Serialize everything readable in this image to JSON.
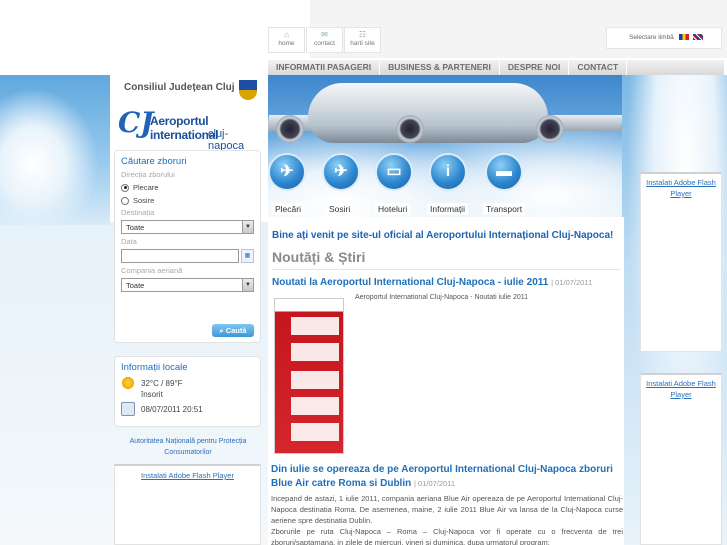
{
  "top_nav": [
    {
      "label": "home",
      "icon": "home-icon"
    },
    {
      "label": "contact",
      "icon": "mail-icon"
    },
    {
      "label": "harti site",
      "icon": "sitemap-icon"
    }
  ],
  "language": {
    "label": "Selectare limbă"
  },
  "menu": [
    "INFORMATII PASAGERI",
    "BUSINESS & PARTENERI",
    "DESPRE NOI",
    "CONTACT"
  ],
  "logos": {
    "council": "Consiliul Județean Cluj",
    "airport_mark": "CJ",
    "airport_line1": "Aeroportul international",
    "airport_line2": "cluj-napoca"
  },
  "quick_links": [
    "Plecări",
    "Sosiri",
    "Hoteluri",
    "Informații",
    "Transport"
  ],
  "search": {
    "title": "Căutare zboruri",
    "direction_label": "Direcția zborului",
    "options": [
      "Plecare",
      "Sosire"
    ],
    "selected": "Plecare",
    "destination_label": "Destinația",
    "destination_value": "Toate",
    "date_label": "Data",
    "date_value": "",
    "airline_label": "Compania aeriană",
    "airline_value": "Toate",
    "button": "Caută"
  },
  "local_info": {
    "title": "Informații locale",
    "temperature": "32°C / 89°F",
    "condition": "însorit",
    "datetime": "08/07/2011 20:51"
  },
  "anpc_link": "Autoritatea Națională pentru Protecția Consumatorilor",
  "flash_link": "Instalati Adobe Flash Player",
  "main": {
    "welcome": "Bine ați venit pe site-ul oficial al Aeroportului Internațional Cluj-Napoca!",
    "section": "Noutăți & Știri",
    "news": [
      {
        "title": "Noutati la Aeroportul International Cluj-Napoca - iulie 2011",
        "date": "| 01/07/2011",
        "caption": "Aeroportul International Cluj-Napoca - Noutati iulie 2011"
      },
      {
        "title": "Din iulie se opereaza de pe Aeroportul International Cluj-Napoca zboruri Blue Air catre Roma si Dublin",
        "date": "| 01/07/2011",
        "text": "Incepand de astazi, 1 iulie 2011, compania aeriana Blue Air opereaza de pe Aeroportul International Cluj-Napoca destinatia Roma. De asemenea, maine, 2 iulie 2011 Blue Air va lansa de la Cluj-Napoca curse aeriene spre destinatia Dublin.",
        "text2": "Zborurile pe ruta Cluj-Napoca – Roma – Cluj-Napoca vor fi operate cu o frecventa de trei zboruri/saptamana, in zilele de miercuri, vineri si duminica, dupa urmatorul program:"
      }
    ]
  }
}
